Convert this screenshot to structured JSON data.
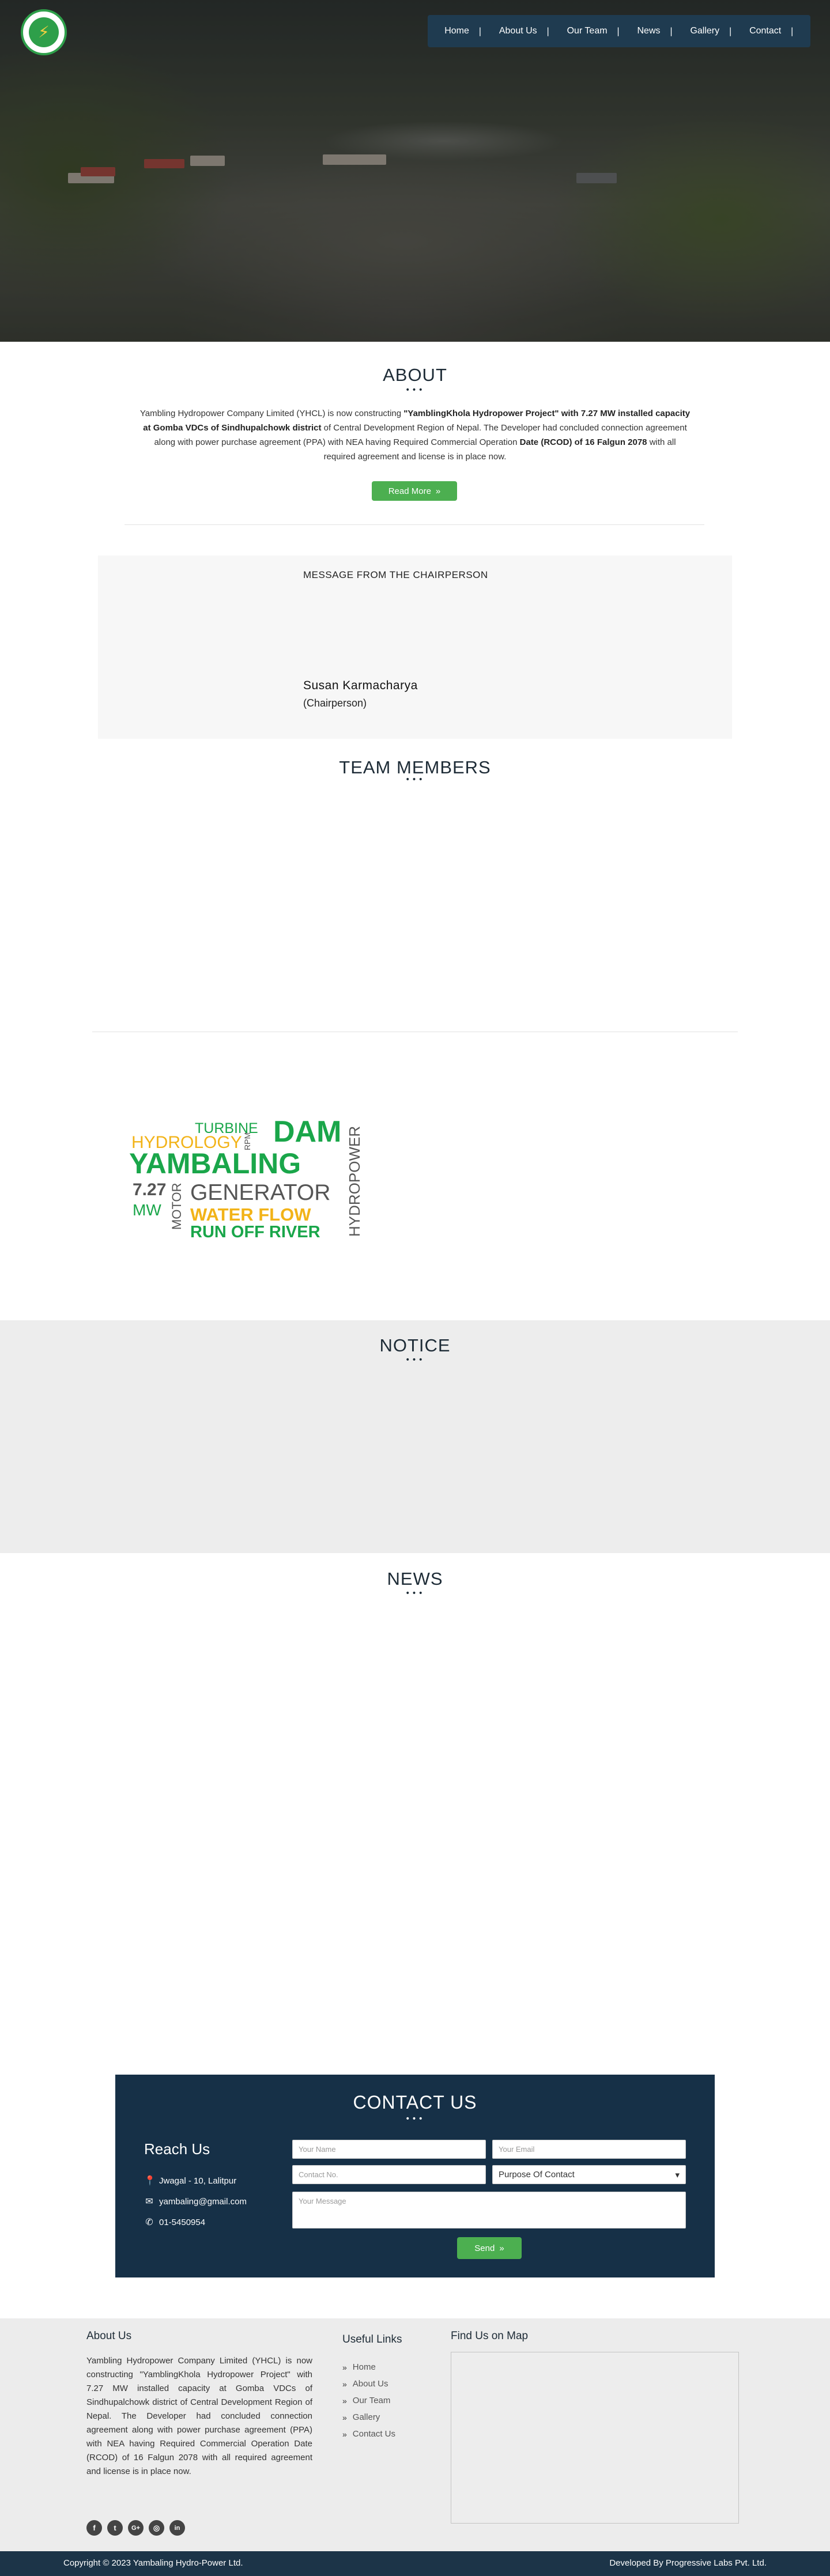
{
  "nav": {
    "items": [
      {
        "label": "Home"
      },
      {
        "label": "About Us"
      },
      {
        "label": "Our Team"
      },
      {
        "label": "News"
      },
      {
        "label": "Gallery"
      },
      {
        "label": "Contact"
      }
    ],
    "separator": "|"
  },
  "about": {
    "title": "ABOUT",
    "dots": "•••",
    "text_1": "Yambling Hydropower Company Limited (YHCL) is now constructing ",
    "text_bold_1": "\"YamblingKhola Hydropower Project\" with 7.27 MW installed capacity at Gomba VDCs of Sindhupalchowk district",
    "text_2": " of Central Development Region of Nepal. The Developer had concluded connection agreement along with power purchase agreement (PPA) with NEA having Required Commercial Operation ",
    "text_bold_2": "Date (RCOD) of 16 Falgun 2078",
    "text_3": " with all required agreement and license is in place now.",
    "read_more": "Read More",
    "read_more_icon": "»"
  },
  "chairperson": {
    "title": "MESSAGE FROM THE CHAIRPERSON",
    "name": "Susan Karmacharya",
    "role": "(Chairperson)"
  },
  "team": {
    "title": "TEAM MEMBERS",
    "dots": "•••"
  },
  "wordcloud": {
    "turbine": "TURBINE",
    "hydrology": "HYDROLOGY",
    "rpm": "RPM",
    "dam": "DAM",
    "yambaling": "YAMBALING",
    "hydropower": "HYDROPOWER",
    "capacity": "7.27",
    "mw": "MW",
    "motor": "MOTOR",
    "generator": "GENERATOR",
    "water_flow": "WATER FLOW",
    "run_off_river": "RUN OFF RIVER"
  },
  "notice": {
    "title": "NOTICE",
    "dots": "•••"
  },
  "news": {
    "title": "NEWS",
    "dots": "•••"
  },
  "contact": {
    "title": "CONTACT US",
    "dots": "•••",
    "reach_title": "Reach Us",
    "address": "Jwagal - 10, Lalitpur",
    "email": "yambaling@gmail.com",
    "phone": "01-5450954",
    "form": {
      "name_placeholder": "Your Name",
      "email_placeholder": "Your Email",
      "contact_placeholder": "Contact No.",
      "purpose_selected": "Purpose Of Contact",
      "message_placeholder": "Your Message",
      "send_label": "Send",
      "send_icon": "»"
    }
  },
  "footer": {
    "about_title": "About Us",
    "about_text": "Yambling Hydropower Company Limited (YHCL) is now constructing \"YamblingKhola Hydropower Project\" with 7.27 MW installed capacity at Gomba VDCs of Sindhupalchowk district of Central Development Region of Nepal. The Developer had concluded connection agreement along with power purchase agreement (PPA) with NEA having Required Commercial Operation Date (RCOD) of 16 Falgun 2078 with all required agreement and license is in place now.",
    "links_title": "Useful Links",
    "links": [
      {
        "label": "Home"
      },
      {
        "label": "About Us"
      },
      {
        "label": "Our Team"
      },
      {
        "label": "Gallery"
      },
      {
        "label": "Contact Us"
      }
    ],
    "map_title": "Find Us on Map",
    "social": [
      {
        "name": "facebook-icon",
        "glyph": "f"
      },
      {
        "name": "twitter-icon",
        "glyph": "t"
      },
      {
        "name": "google-plus-icon",
        "glyph": "G+"
      },
      {
        "name": "instagram-icon",
        "glyph": "◎"
      },
      {
        "name": "linkedin-icon",
        "glyph": "in"
      }
    ],
    "copyright": "Copyright © 2023 Yambaling Hydro-Power Ltd.",
    "developer": "Developed By Progressive Labs Pvt. Ltd."
  },
  "colors": {
    "nav_bg": "#1f3b50",
    "accent_green": "#4caf50",
    "contact_bg": "#163047",
    "footer_bar": "#1c3448"
  }
}
